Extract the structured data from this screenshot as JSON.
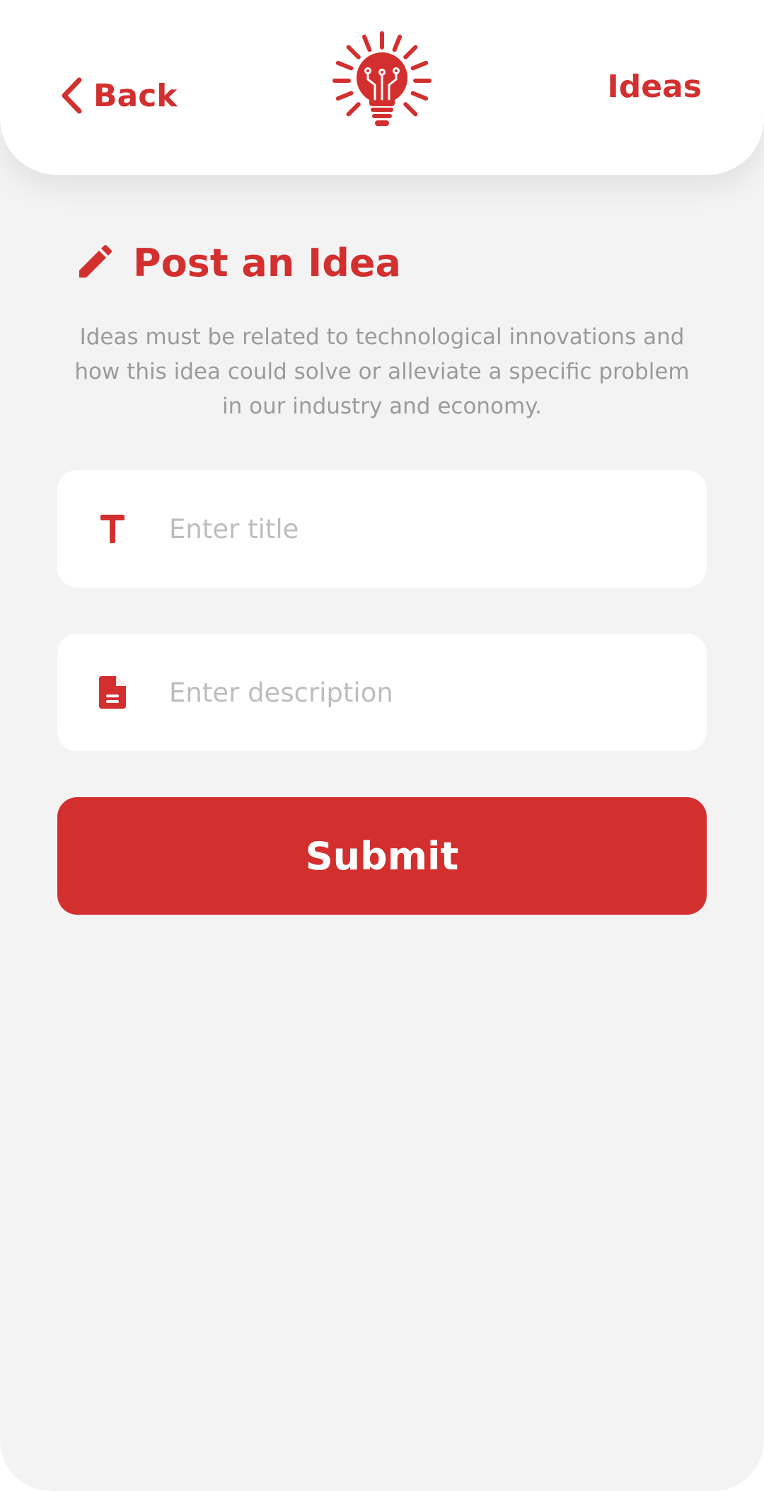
{
  "header": {
    "back_label": "Back",
    "logo_icon": "lightbulb-circuit-sun-logo",
    "ideas_label": "Ideas"
  },
  "main": {
    "title_icon": "pencil-icon",
    "title": "Post an Idea",
    "description": "Ideas must be related to technological innovations and how this idea could solve or alleviate a specific problem in our industry and economy.",
    "title_field": {
      "icon": "text-t-icon",
      "value": "",
      "placeholder": "Enter title"
    },
    "description_field": {
      "icon": "document-icon",
      "value": "",
      "placeholder": "Enter description"
    },
    "submit_label": "Submit"
  },
  "colors": {
    "accent": "#d32f2f",
    "background": "#f3f3f3",
    "card": "#ffffff",
    "muted_text": "#9b9b9b",
    "placeholder": "#bdbdbd"
  }
}
